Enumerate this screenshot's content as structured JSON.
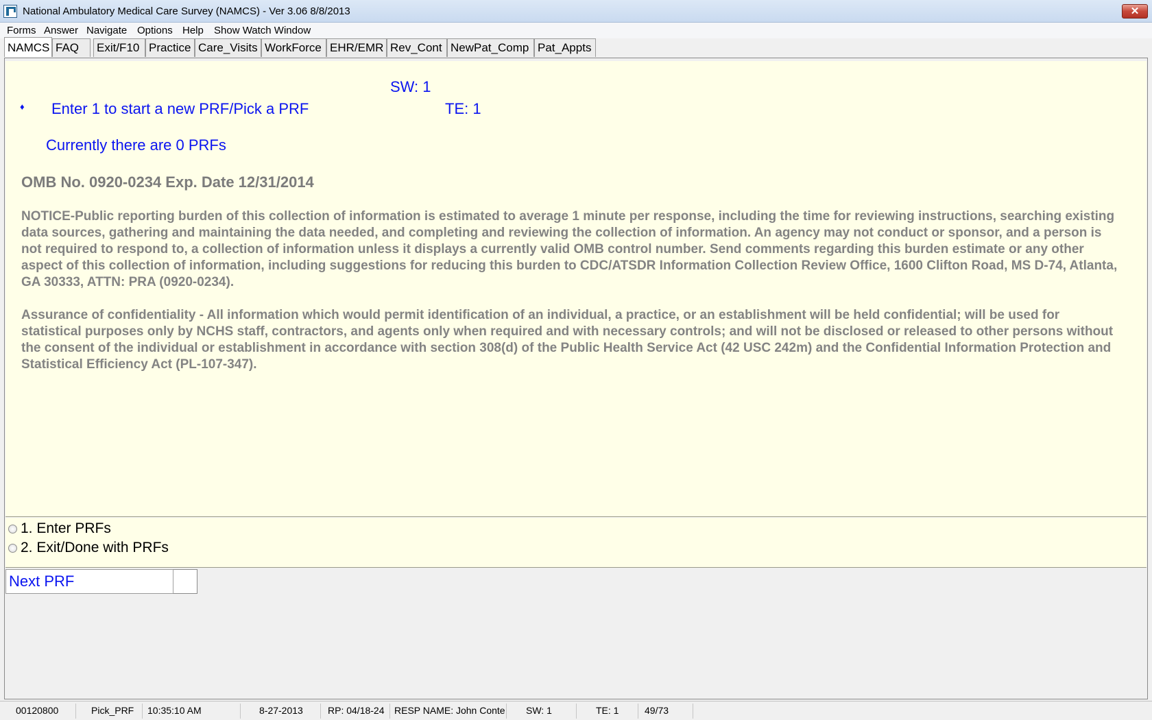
{
  "window": {
    "title": "National Ambulatory Medical Care Survey (NAMCS) - Ver 3.06 8/8/2013",
    "close_glyph": "✕",
    "icon": "namcs-app-icon"
  },
  "menu": [
    "Forms",
    "Answer",
    "Navigate",
    "Options",
    "Help",
    "Show Watch Window"
  ],
  "tabs": [
    "NAMCS",
    "FAQ",
    "Exit/F10",
    "Practice",
    "Care_Visits",
    "WorkForce",
    "EHR/EMR",
    "Rev_Cont",
    "NewPat_Comp",
    "Pat_Appts"
  ],
  "active_tab": "NAMCS",
  "question": {
    "sw": "SW: 1",
    "te": "TE: 1",
    "bullet": "♦",
    "prompt": "Enter 1 to start a new PRF/Pick a PRF",
    "count_text": "Currently there are 0 PRFs",
    "omb": "OMB No. 0920-0234 Exp. Date 12/31/2014",
    "notice": "NOTICE-Public reporting burden of this collection of information is estimated to average 1 minute per response, including the time for reviewing instructions, searching existing data sources, gathering and maintaining the data needed, and completing and reviewing the collection of information. An agency may not conduct or sponsor, and a person is not required to respond to, a collection of information unless it displays a currently valid OMB control number. Send comments regarding this burden estimate or any other aspect of this collection of information, including suggestions for reducing this burden to CDC/ATSDR Information Collection Review Office, 1600 Clifton Road, MS D-74, Atlanta, GA 30333, ATTN: PRA (0920-0234).",
    "confidentiality": "Assurance of confidentiality - All information which would permit identification of an individual, a practice, or an establishment will be held confidential; will be used for statistical purposes only by NCHS staff, contractors, and agents only when required and with necessary controls; and will not be disclosed or released to other persons without the consent of the individual or establishment in accordance with section 308(d) of the Public Health Service Act (42 USC 242m) and the Confidential Information Protection and Statistical Efficiency Act (PL-107-347)."
  },
  "answers": [
    {
      "label": "1. Enter PRFs",
      "selected": false
    },
    {
      "label": "2. Exit/Done with PRFs",
      "selected": false
    }
  ],
  "entry": {
    "label": "Next PRF",
    "value": ""
  },
  "status": {
    "case_id": "00120800",
    "field": "Pick_PRF",
    "time": "10:35:10 AM",
    "date": "8-27-2013",
    "rp": "RP: 04/18-24",
    "resp_name": "RESP NAME: John  Conte",
    "sw": "SW: 1",
    "te": "TE: 1",
    "progress": "49/73"
  }
}
